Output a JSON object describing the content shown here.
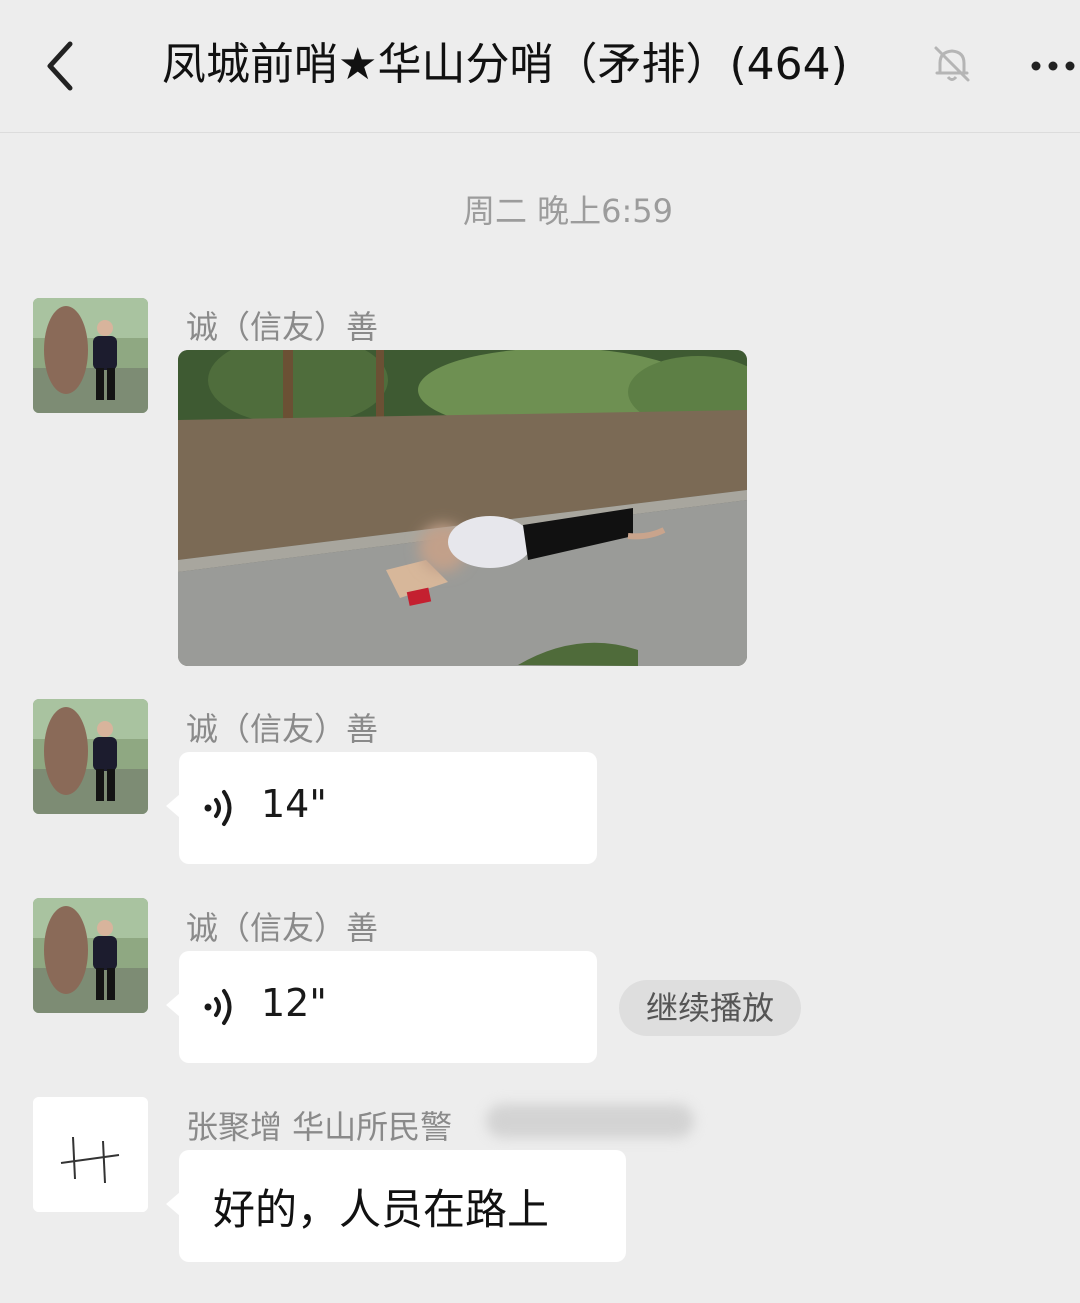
{
  "header": {
    "back_icon": "chevron-left-icon",
    "title": "凤城前哨★华山分哨（矛排）(464)",
    "mute_icon": "bell-muted-icon",
    "more_icon": "more-horizontal-icon"
  },
  "chat": {
    "timestamp": "周二 晚上6:59",
    "messages": [
      {
        "sender": "诚（信友）善",
        "type": "image"
      },
      {
        "sender": "诚（信友）善",
        "type": "voice",
        "duration": "14\""
      },
      {
        "sender": "诚（信友）善",
        "type": "voice",
        "duration": "12\"",
        "action_label": "继续播放"
      },
      {
        "sender": "张聚增 华山所民警",
        "type": "text",
        "text": "好的，人员在路上"
      }
    ]
  },
  "colors": {
    "background": "#ededed",
    "bubble": "#ffffff",
    "secondary_text": "#8a8a8a"
  }
}
